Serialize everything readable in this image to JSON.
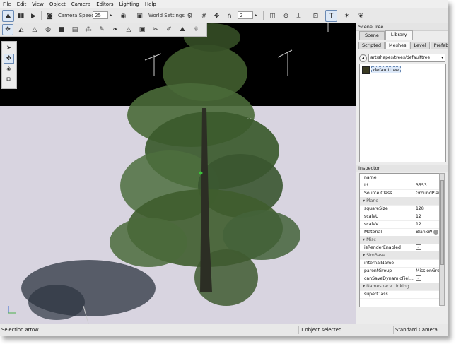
{
  "menu": [
    "File",
    "Edit",
    "View",
    "Object",
    "Camera",
    "Editors",
    "Lighting",
    "Help"
  ],
  "toolbar": {
    "camera_speed_label": "Camera Speed",
    "camera_speed_value": "25",
    "world_settings_label": "World Settings",
    "grid_value": "2"
  },
  "scene_tree": {
    "title": "Scene Tree",
    "tabs": [
      "Scene",
      "Library"
    ],
    "active_tab": "Library",
    "subtabs": [
      "Scripted",
      "Meshes",
      "Level",
      "Prefabs"
    ],
    "active_subtab": "Meshes",
    "path": "art/shapes/trees/defaulttree",
    "items": [
      "defaulttree"
    ]
  },
  "inspector": {
    "title": "Inspector",
    "rows": [
      {
        "key": "name",
        "value": "",
        "type": "prop"
      },
      {
        "key": "Id",
        "value": "3553",
        "type": "prop"
      },
      {
        "key": "Source Class",
        "value": "GroundPlane",
        "type": "prop"
      },
      {
        "key": "Plane",
        "value": "",
        "type": "group"
      },
      {
        "key": "squareSize",
        "value": "128",
        "type": "prop"
      },
      {
        "key": "scaleU",
        "value": "12",
        "type": "prop"
      },
      {
        "key": "scaleV",
        "value": "12",
        "type": "prop"
      },
      {
        "key": "Material",
        "value": "BlankW",
        "type": "prop"
      },
      {
        "key": "Misc",
        "value": "",
        "type": "group"
      },
      {
        "key": "isRenderEnabled",
        "value": "✓",
        "type": "check"
      },
      {
        "key": "SimBase",
        "value": "",
        "type": "group"
      },
      {
        "key": "internalName",
        "value": "",
        "type": "prop"
      },
      {
        "key": "parentGroup",
        "value": "MissionGrou",
        "type": "prop"
      },
      {
        "key": "canSaveDynamicFiel...",
        "value": "✓",
        "type": "check"
      },
      {
        "key": "Namespace Linking",
        "value": "",
        "type": "group"
      },
      {
        "key": "superClass",
        "value": "",
        "type": "prop"
      }
    ]
  },
  "status": {
    "left": "Selection arrow.",
    "middle": "1 object selected",
    "right": "Standard Camera"
  },
  "colors": {
    "sky": "#000000",
    "ground": "#d8d4e0",
    "foliage": "#3e5a2c",
    "selection": "#dce8f8"
  }
}
